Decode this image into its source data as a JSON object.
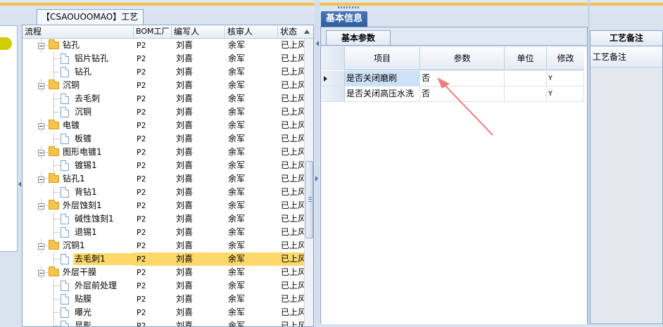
{
  "window": {
    "tree_tab_label": "【CSAOUOOMAO】工艺流程",
    "info_tab_label": "基本信息"
  },
  "tree": {
    "columns": [
      "流程",
      "BOM工厂",
      "编写人",
      "核审人",
      "状态"
    ],
    "rows": [
      {
        "level": 1,
        "type": "folder",
        "name": "钻孔",
        "bom": "P2",
        "writer": "刘喜",
        "reviewer": "余军",
        "status": "已上风"
      },
      {
        "level": 2,
        "type": "doc",
        "name": "铝片钻孔",
        "bom": "P2",
        "writer": "刘喜",
        "reviewer": "余军",
        "status": "已上风"
      },
      {
        "level": 2,
        "type": "doc",
        "name": "钻孔",
        "bom": "P2",
        "writer": "刘喜",
        "reviewer": "余军",
        "status": "已上风"
      },
      {
        "level": 1,
        "type": "folder",
        "name": "沉铜",
        "bom": "P2",
        "writer": "刘喜",
        "reviewer": "余军",
        "status": "已上风"
      },
      {
        "level": 2,
        "type": "doc",
        "name": "去毛刺",
        "bom": "P2",
        "writer": "刘喜",
        "reviewer": "余军",
        "status": "已上风"
      },
      {
        "level": 2,
        "type": "doc",
        "name": "沉铜",
        "bom": "P2",
        "writer": "刘喜",
        "reviewer": "余军",
        "status": "已上风"
      },
      {
        "level": 1,
        "type": "folder",
        "name": "电镀",
        "bom": "P2",
        "writer": "刘喜",
        "reviewer": "余军",
        "status": "已上风"
      },
      {
        "level": 2,
        "type": "doc",
        "name": "板镀",
        "bom": "P2",
        "writer": "刘喜",
        "reviewer": "余军",
        "status": "已上风"
      },
      {
        "level": 1,
        "type": "folder",
        "name": "图形电镀1",
        "bom": "P2",
        "writer": "刘喜",
        "reviewer": "余军",
        "status": "已上风"
      },
      {
        "level": 2,
        "type": "doc",
        "name": "镀锡1",
        "bom": "P2",
        "writer": "刘喜",
        "reviewer": "余军",
        "status": "已上风"
      },
      {
        "level": 1,
        "type": "folder",
        "name": "钻孔1",
        "bom": "P2",
        "writer": "刘喜",
        "reviewer": "余军",
        "status": "已上风"
      },
      {
        "level": 2,
        "type": "doc",
        "name": "背钻1",
        "bom": "P2",
        "writer": "刘喜",
        "reviewer": "余军",
        "status": "已上风"
      },
      {
        "level": 1,
        "type": "folder",
        "name": "外层蚀刻1",
        "bom": "P2",
        "writer": "刘喜",
        "reviewer": "余军",
        "status": "已上风"
      },
      {
        "level": 2,
        "type": "doc",
        "name": "碱性蚀刻1",
        "bom": "P2",
        "writer": "刘喜",
        "reviewer": "余军",
        "status": "已上风"
      },
      {
        "level": 2,
        "type": "doc",
        "name": "退锡1",
        "bom": "P2",
        "writer": "刘喜",
        "reviewer": "余军",
        "status": "已上风"
      },
      {
        "level": 1,
        "type": "folder",
        "name": "沉铜1",
        "bom": "P2",
        "writer": "刘喜",
        "reviewer": "余军",
        "status": "已上风"
      },
      {
        "level": 2,
        "type": "doc",
        "name": "去毛刺1",
        "bom": "P2",
        "writer": "刘喜",
        "reviewer": "余军",
        "status": "已上风",
        "selected": true
      },
      {
        "level": 1,
        "type": "folder",
        "name": "外层干膜",
        "bom": "P2",
        "writer": "刘喜",
        "reviewer": "余军",
        "status": "已上风"
      },
      {
        "level": 2,
        "type": "doc",
        "name": "外层前处理",
        "bom": "P2",
        "writer": "刘喜",
        "reviewer": "余军",
        "status": "已上风"
      },
      {
        "level": 2,
        "type": "doc",
        "name": "贴膜",
        "bom": "P2",
        "writer": "刘喜",
        "reviewer": "余军",
        "status": "已上风"
      },
      {
        "level": 2,
        "type": "doc",
        "name": "曝光",
        "bom": "P2",
        "writer": "刘喜",
        "reviewer": "余军",
        "status": "已上风"
      },
      {
        "level": 2,
        "type": "doc",
        "name": "显影",
        "bom": "P2",
        "writer": "刘喜",
        "reviewer": "余军",
        "status": "已上风"
      }
    ]
  },
  "params": {
    "sub_tab_label": "基本参数",
    "columns": [
      "项目",
      "参数",
      "单位",
      "修改"
    ],
    "rows": [
      {
        "item": "是否关闭磨刷",
        "value": "否",
        "unit": "",
        "modified": "Y",
        "current": true
      },
      {
        "item": "是否关闭高压水洗",
        "value": "否",
        "unit": "",
        "modified": "Y",
        "current": false
      }
    ]
  },
  "remarks": {
    "tab_label": "工艺备注",
    "column": "工艺备注"
  },
  "colors": {
    "selection": "#fdd86b",
    "tab_active": "#2f5e9f",
    "annotation_arrow": "#e8807c",
    "cell_highlight": "#cde1f8"
  }
}
